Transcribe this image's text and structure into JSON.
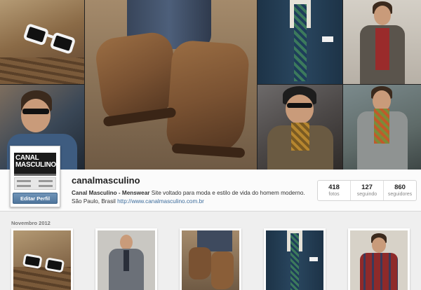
{
  "profile": {
    "logo_text_line1": "CANAL",
    "logo_text_line2": "MASCULINO",
    "edit_button": "Editar Perfil",
    "username": "canalmasculino",
    "bio_name": "Canal Masculino - Menswear",
    "bio_text": " Site voltado para moda e estilo de vida do homem moderno. São Paulo, Brasil ",
    "bio_link": "http://www.canalmasculino.com.br"
  },
  "stats": [
    {
      "value": "418",
      "label": "fotos"
    },
    {
      "value": "127",
      "label": "seguindo"
    },
    {
      "value": "860",
      "label": "seguidores"
    }
  ],
  "timeline": {
    "month": "Novembro 2012"
  },
  "colors": {
    "link": "#3b6b9b",
    "button": "#4f759c"
  }
}
